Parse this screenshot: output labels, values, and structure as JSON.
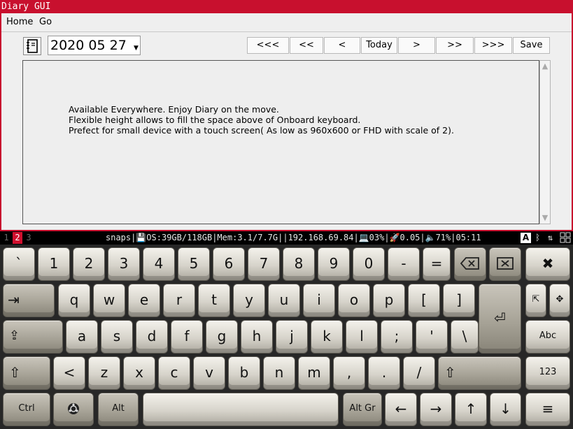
{
  "window": {
    "title": "Diary GUI"
  },
  "menu": {
    "items": [
      "Home",
      "Go"
    ]
  },
  "toolbar": {
    "date_value": "2020 05 27",
    "nav": [
      "<<<",
      "<<",
      "<",
      "Today",
      ">",
      ">>",
      ">>>"
    ],
    "save_label": "Save"
  },
  "editor": {
    "text": "Available Everywhere. Enjoy Diary on the move.\nFlexible height allows to fill the space above of Onboard keyboard.\nPrefect for small device with a touch screen( As low as 960x600 or FHD with scale of 2)."
  },
  "panel": {
    "workspaces": [
      "1",
      "2",
      "3"
    ],
    "active_workspace": "2",
    "status_text": "snaps|💾OS:39GB/118GB|Mem:3.1/7.7G||192.168.69.84|💻03%|🚀0.05|🔈71%|05:11",
    "keyboard_layout": "A"
  },
  "keyboard": {
    "row1": [
      "`",
      "1",
      "2",
      "3",
      "4",
      "5",
      "6",
      "7",
      "8",
      "9",
      "0",
      "-",
      "="
    ],
    "row2": [
      "q",
      "w",
      "e",
      "r",
      "t",
      "y",
      "u",
      "i",
      "o",
      "p",
      "[",
      "]"
    ],
    "row3": [
      "a",
      "s",
      "d",
      "f",
      "g",
      "h",
      "j",
      "k",
      "l",
      ";",
      "'",
      "\\"
    ],
    "row4": [
      "<",
      "z",
      "x",
      "c",
      "v",
      "b",
      "n",
      "m",
      ",",
      ".",
      "/"
    ],
    "ctrl_label": "Ctrl",
    "alt_label": "Alt",
    "altgr_label": "Alt Gr",
    "abc_label": "Abc",
    "num_label": "123",
    "colors": {
      "window_border": "#c8102e",
      "panel_bg": "#000000",
      "key_face": "#e0ded6"
    }
  }
}
